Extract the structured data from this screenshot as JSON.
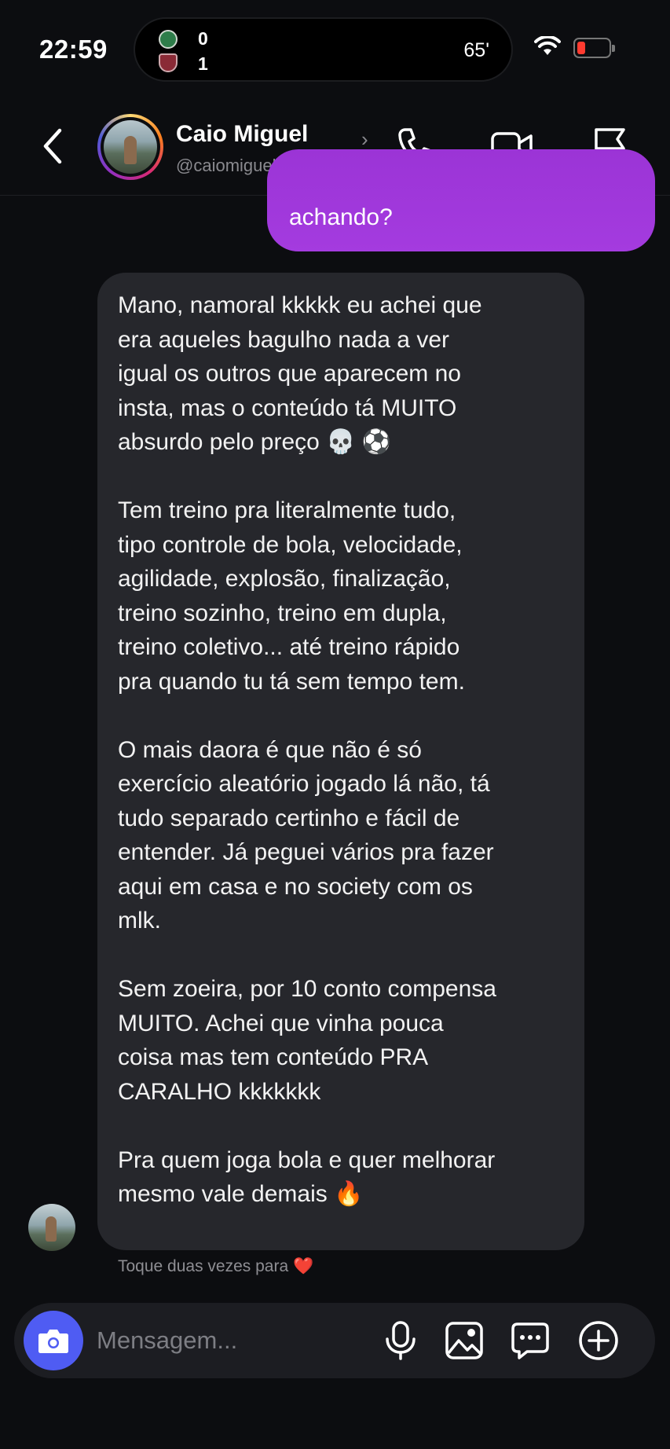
{
  "status_bar": {
    "time": "22:59",
    "score_home": "0",
    "score_away": "1",
    "match_minute": "65'",
    "battery_color": "#ff3b30"
  },
  "header": {
    "name": "Caio Miguel",
    "handle": "@caiomigueldesouz...",
    "chevron": "›",
    "icons": [
      "back-icon",
      "phone-icon",
      "video-icon",
      "flag-icon"
    ],
    "ring_colors": [
      "#feda75",
      "#fa7e1e",
      "#d62976",
      "#962fbf",
      "#4f5bd5"
    ]
  },
  "messages": {
    "outgoing_partial": "achando?",
    "incoming": "Mano, namoral kkkkk eu achei que\nera aqueles bagulho nada a ver\nigual os outros que aparecem no\ninsta, mas o conteúdo tá MUITO\nabsurdo pelo preço 💀 ⚽\n\nTem treino pra literalmente tudo,\ntipo controle de bola, velocidade,\nagilidade, explosão, finalização,\ntreino sozinho, treino em dupla,\ntreino coletivo... até treino rápido\npra quando tu tá sem tempo tem.\n\nO mais daora é que não é só\nexercício aleatório jogado lá não, tá\ntudo separado certinho e fácil de\nentender. Já peguei vários pra fazer\naqui em casa e no society com os\nmlk.\n\nSem zoeira, por 10 conto compensa\nMUITO. Achei que vinha pouca\ncoisa mas tem conteúdo PRA\nCARALHO kkkkkkk\n\nPra quem joga bola e quer melhorar\nmesmo vale demais 🔥",
    "outgoing_color": "#a43bdf",
    "incoming_color": "#26272c"
  },
  "hint": "Toque duas vezes para ❤️",
  "composer": {
    "placeholder": "Mensagem...",
    "camera_color": "#4f5cf3",
    "icons": [
      "camera-icon",
      "microphone-icon",
      "gallery-icon",
      "sticker-icon",
      "plus-icon"
    ]
  }
}
